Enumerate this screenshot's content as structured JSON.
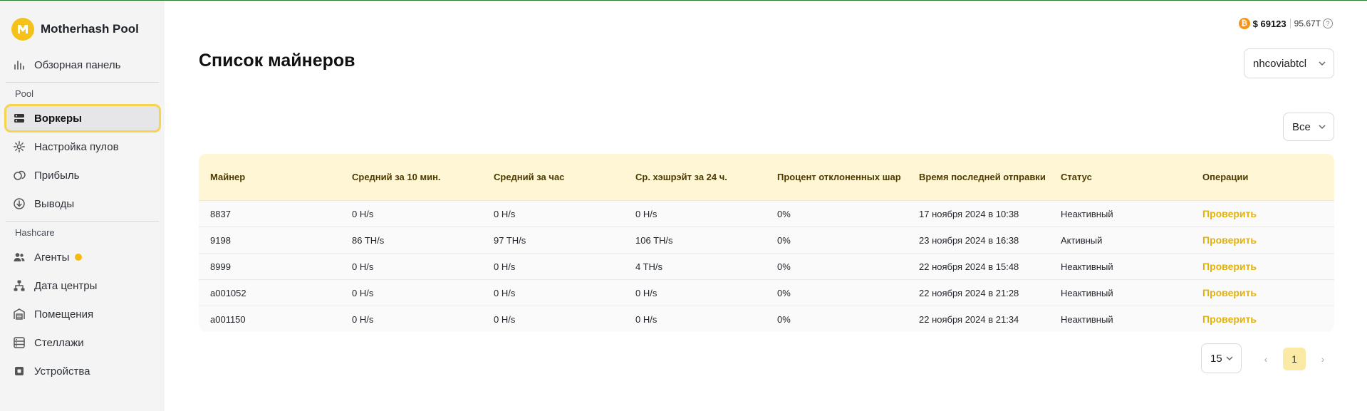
{
  "brand": {
    "name": "Motherhash Pool",
    "logo_letter": "M"
  },
  "sidebar": {
    "dashboard": {
      "label": "Обзорная панель",
      "icon": "bar-chart-icon"
    },
    "pool_section": "Pool",
    "pool_items": [
      {
        "label": "Воркеры",
        "icon": "server-icon",
        "active": true
      },
      {
        "label": "Настройка пулов",
        "icon": "gear-icon"
      },
      {
        "label": "Прибыль",
        "icon": "coins-icon"
      },
      {
        "label": "Выводы",
        "icon": "download-circle-icon"
      }
    ],
    "hashcare_section": "Hashcare",
    "hashcare_items": [
      {
        "label": "Агенты",
        "icon": "users-icon",
        "has_badge": true
      },
      {
        "label": "Дата центры",
        "icon": "hierarchy-icon"
      },
      {
        "label": "Помещения",
        "icon": "warehouse-icon"
      },
      {
        "label": "Стеллажи",
        "icon": "rack-icon"
      },
      {
        "label": "Устройства",
        "icon": "chip-icon"
      }
    ]
  },
  "header": {
    "btc_symbol": "₿",
    "btc_price": "$ 69123",
    "hashrate": "95.67T",
    "help": "?"
  },
  "page": {
    "title": "Список майнеров",
    "account_select": "nhcoviabtcl",
    "filter_select": "Все"
  },
  "table": {
    "columns": [
      "Майнер",
      "Средний за 10 мин.",
      "Средний за час",
      "Ср. хэшрэйт за 24 ч.",
      "Процент отклоненных шар",
      "Время последней отправки",
      "Статус",
      "Операции"
    ],
    "rows": [
      [
        "8837",
        "0 H/s",
        "0 H/s",
        "0 H/s",
        "0%",
        "17 ноября 2024 в 10:38",
        "Неактивный",
        "Проверить"
      ],
      [
        "9198",
        "86 TH/s",
        "97 TH/s",
        "106 TH/s",
        "0%",
        "23 ноября 2024 в 16:38",
        "Активный",
        "Проверить"
      ],
      [
        "8999",
        "0 H/s",
        "0 H/s",
        "4 TH/s",
        "0%",
        "22 ноября 2024 в 15:48",
        "Неактивный",
        "Проверить"
      ],
      [
        "a001052",
        "0 H/s",
        "0 H/s",
        "0 H/s",
        "0%",
        "22 ноября 2024 в 21:28",
        "Неактивный",
        "Проверить"
      ],
      [
        "a001150",
        "0 H/s",
        "0 H/s",
        "0 H/s",
        "0%",
        "22 ноября 2024 в 21:34",
        "Неактивный",
        "Проверить"
      ]
    ]
  },
  "pagination": {
    "page_size": "15",
    "prev": "‹",
    "current_page": "1",
    "next": "›"
  },
  "colors": {
    "accent": "#f5c21b",
    "header_bg": "#fff6d6",
    "action": "#e3b20a",
    "sidebar_bg": "#f4f4f5"
  }
}
